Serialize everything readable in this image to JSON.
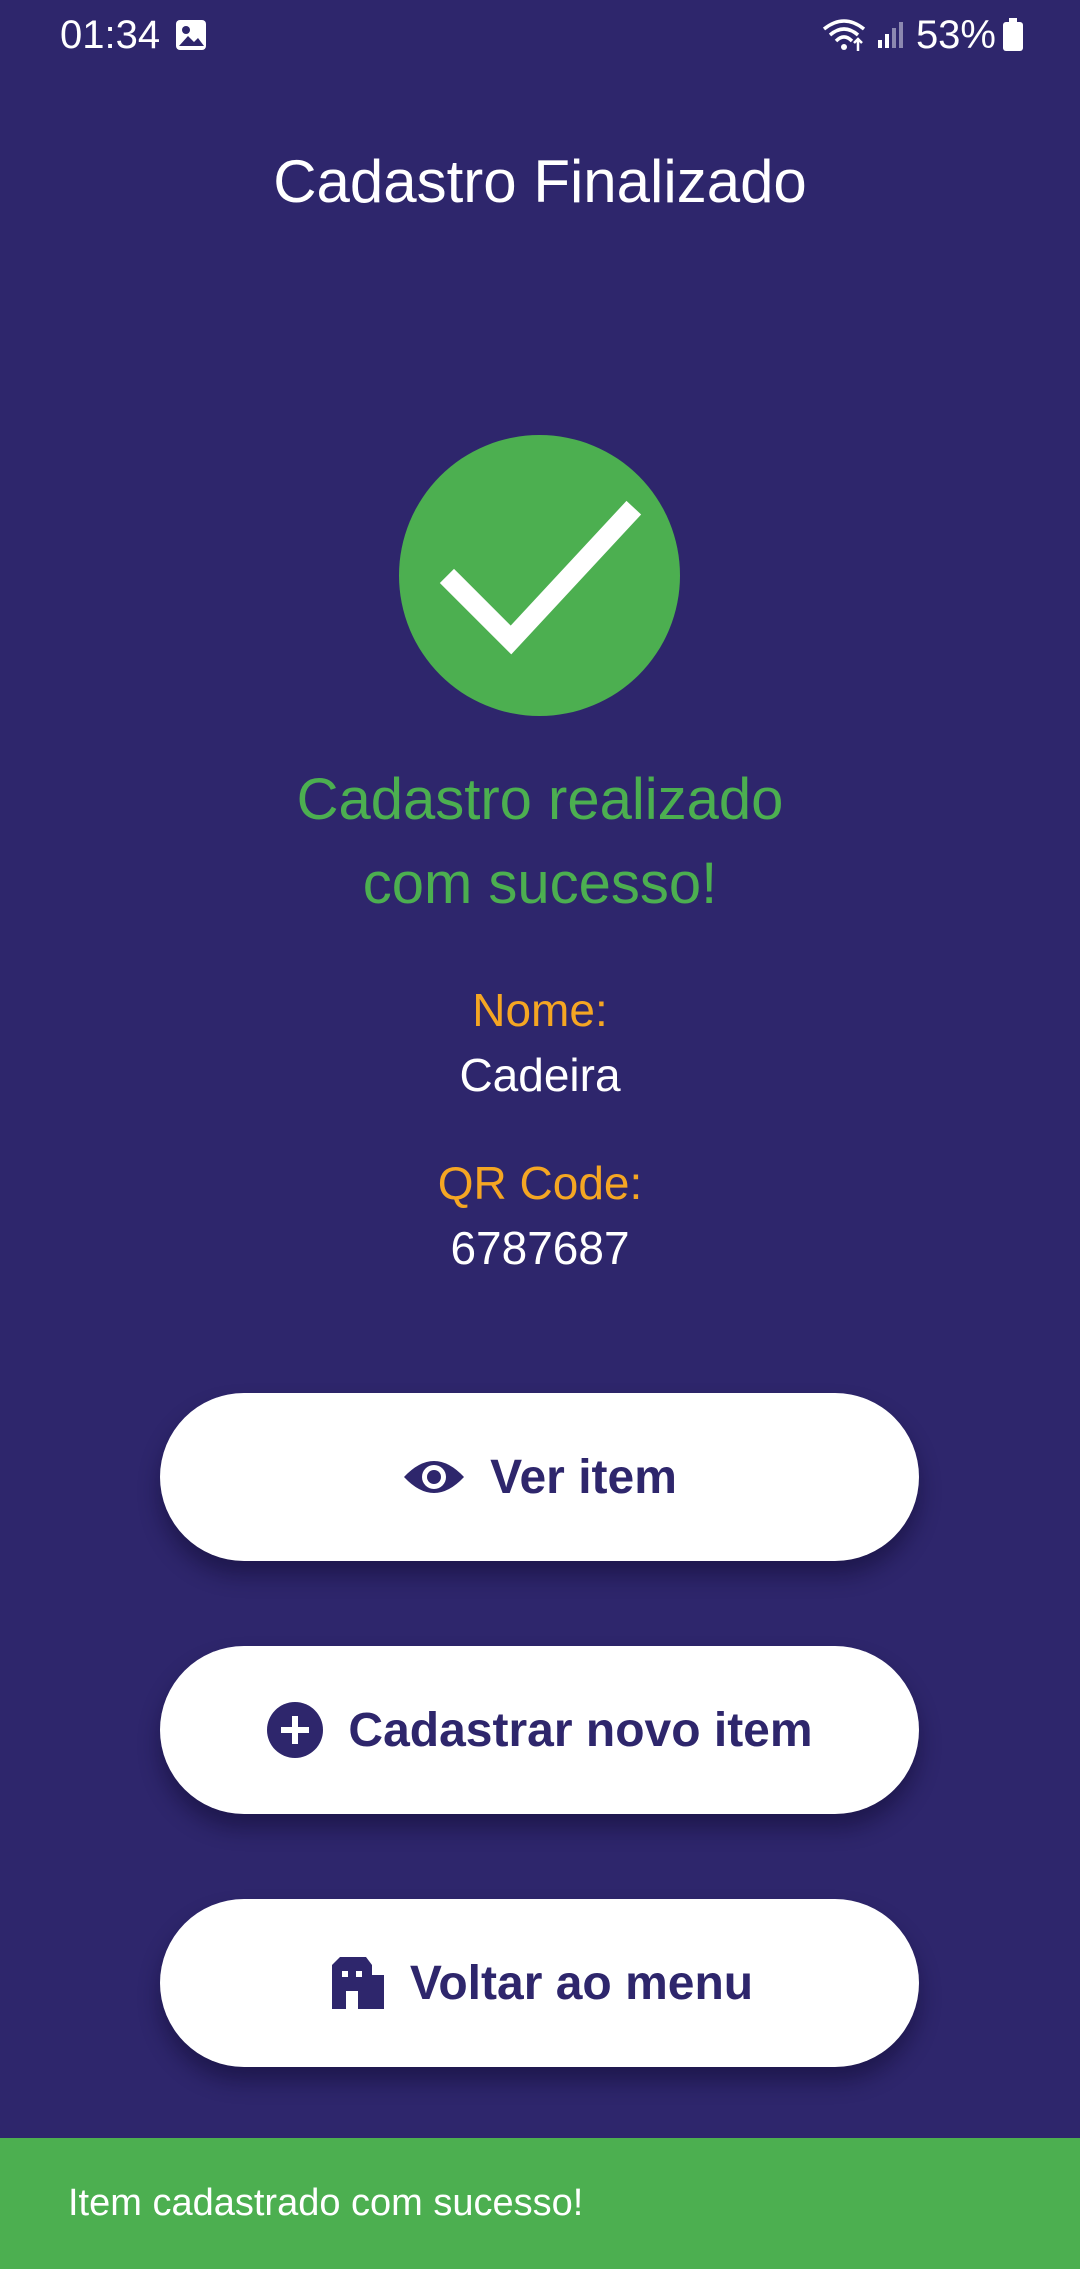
{
  "status_bar": {
    "time": "01:34",
    "battery": "53%",
    "icons": [
      "gallery-icon",
      "wifi-icon",
      "signal-icon",
      "battery-icon"
    ]
  },
  "header": {
    "title": "Cadastro Finalizado"
  },
  "success": {
    "icon": "check-icon",
    "message_line1": "Cadastro realizado",
    "message_line2": "com sucesso!"
  },
  "details": {
    "name_label": "Nome:",
    "name_value": "Cadeira",
    "qr_label": "QR Code:",
    "qr_value": "6787687"
  },
  "actions": {
    "view_item": {
      "label": "Ver item",
      "icon": "eye-icon"
    },
    "new_item": {
      "label": "Cadastrar novo item",
      "icon": "plus-circle-icon"
    },
    "back_menu": {
      "label": "Voltar ao menu",
      "icon": "house-icon"
    }
  },
  "snackbar": {
    "text": "Item cadastrado com sucesso!"
  },
  "colors": {
    "background": "#2e266c",
    "success": "#4caf50",
    "label": "#f5a623",
    "button_bg": "#ffffff",
    "button_text": "#2e266c"
  }
}
